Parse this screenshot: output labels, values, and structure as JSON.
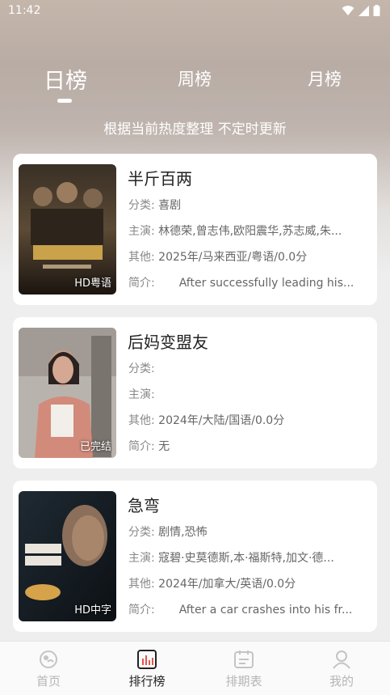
{
  "status_bar": {
    "time": "11:42"
  },
  "tabs": {
    "daily": "日榜",
    "weekly": "周榜",
    "monthly": "月榜"
  },
  "subtitle": "根据当前热度整理 不定时更新",
  "movies": [
    {
      "title": "半斤百两",
      "badge": "HD粤语",
      "genre_label": "分类:",
      "genre": "喜剧",
      "cast_label": "主演:",
      "cast": "林德荣,曾志伟,欧阳震华,苏志威,朱...",
      "other_label": "其他:",
      "other": "2025年/马来西亚/粤语/0.0分",
      "intro_label": "简介:",
      "intro": "After successfully leading his..."
    },
    {
      "title": "后妈变盟友",
      "badge": "已完结",
      "genre_label": "分类:",
      "genre": "",
      "cast_label": "主演:",
      "cast": "",
      "other_label": "其他:",
      "other": "2024年/大陆/国语/0.0分",
      "intro_label": "简介:",
      "intro": "无"
    },
    {
      "title": "急弯",
      "badge": "HD中字",
      "genre_label": "分类:",
      "genre": "剧情,恐怖",
      "cast_label": "主演:",
      "cast": "寇碧·史莫德斯,本·福斯特,加文·德...",
      "other_label": "其他:",
      "other": "2024年/加拿大/英语/0.0分",
      "intro_label": "简介:",
      "intro": "After a car crashes into his fr..."
    }
  ],
  "bottom_nav": {
    "home": "首页",
    "rank": "排行榜",
    "schedule": "排期表",
    "mine": "我的"
  },
  "colors": {
    "active_text": "#222222",
    "inactive_text": "#b5b5b5",
    "card_bg": "#ffffff"
  }
}
